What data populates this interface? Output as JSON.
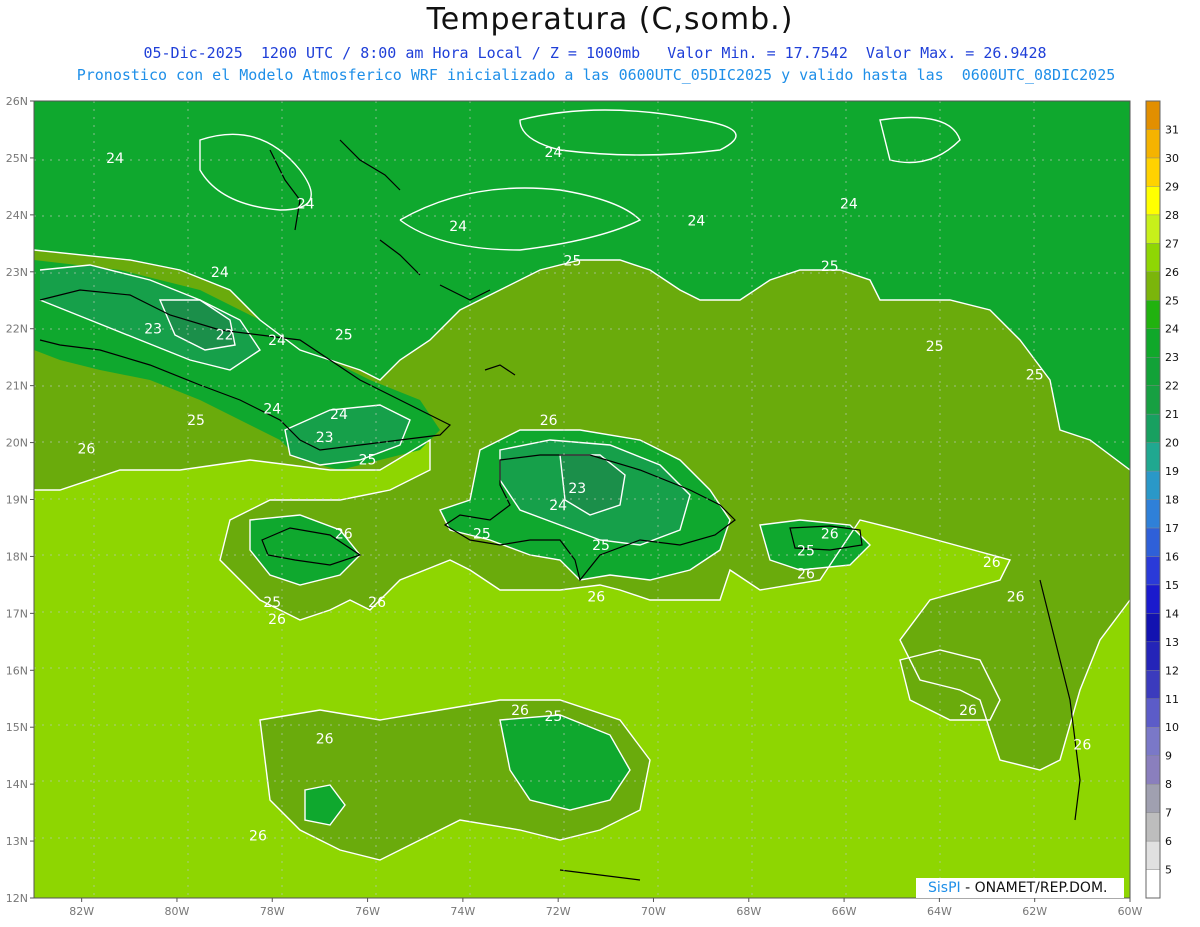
{
  "header": {
    "title": "Temperatura (C,somb.)",
    "line1": "05-Dic-2025  1200 UTC / 8:00 am Hora Local / Z = 1000mb   Valor Min. = 17.7542  Valor Max. = 26.9428",
    "line2": "Pronostico con el Modelo Atmosferico WRF inicializado a las 0600UTC_05DIC2025 y valido hasta las  0600UTC_08DIC2025"
  },
  "credit": {
    "brand": "SisPI",
    "org": " - ONAMET/REP.DOM."
  },
  "map": {
    "lon_ticks": [
      "82W",
      "80W",
      "78W",
      "76W",
      "74W",
      "72W",
      "70W",
      "68W",
      "66W",
      "64W",
      "62W",
      "60W"
    ],
    "lat_ticks": [
      "26N",
      "25N",
      "24N",
      "23N",
      "22N",
      "21N",
      "20N",
      "19N",
      "18N",
      "17N",
      "16N",
      "15N",
      "14N",
      "13N",
      "12N"
    ],
    "contour_labels": [
      {
        "t": "24",
        "lon": -81.3,
        "lat": 25.0
      },
      {
        "t": "24",
        "lon": -77.3,
        "lat": 24.2
      },
      {
        "t": "24",
        "lon": -74.1,
        "lat": 23.8
      },
      {
        "t": "24",
        "lon": -72.1,
        "lat": 25.1
      },
      {
        "t": "24",
        "lon": -69.1,
        "lat": 23.9
      },
      {
        "t": "24",
        "lon": -65.9,
        "lat": 24.2
      },
      {
        "t": "24",
        "lon": -79.1,
        "lat": 23.0
      },
      {
        "t": "25",
        "lon": -71.7,
        "lat": 23.2
      },
      {
        "t": "25",
        "lon": -66.3,
        "lat": 23.1
      },
      {
        "t": "23",
        "lon": -80.5,
        "lat": 22.0
      },
      {
        "t": "22",
        "lon": -79.0,
        "lat": 21.9
      },
      {
        "t": "24",
        "lon": -77.9,
        "lat": 21.8
      },
      {
        "t": "25",
        "lon": -76.5,
        "lat": 21.9
      },
      {
        "t": "25",
        "lon": -64.1,
        "lat": 21.7
      },
      {
        "t": "25",
        "lon": -62.0,
        "lat": 21.2
      },
      {
        "t": "24",
        "lon": -78.0,
        "lat": 20.6
      },
      {
        "t": "24",
        "lon": -76.6,
        "lat": 20.5
      },
      {
        "t": "25",
        "lon": -79.6,
        "lat": 20.4
      },
      {
        "t": "23",
        "lon": -76.9,
        "lat": 20.1
      },
      {
        "t": "26",
        "lon": -81.9,
        "lat": 19.9
      },
      {
        "t": "26",
        "lon": -72.2,
        "lat": 20.4
      },
      {
        "t": "25",
        "lon": -76.0,
        "lat": 19.7
      },
      {
        "t": "23",
        "lon": -71.6,
        "lat": 19.2
      },
      {
        "t": "24",
        "lon": -72.0,
        "lat": 18.9
      },
      {
        "t": "26",
        "lon": -76.5,
        "lat": 18.4
      },
      {
        "t": "25",
        "lon": -73.6,
        "lat": 18.4
      },
      {
        "t": "25",
        "lon": -71.1,
        "lat": 18.2
      },
      {
        "t": "26",
        "lon": -66.3,
        "lat": 18.4
      },
      {
        "t": "25",
        "lon": -66.8,
        "lat": 18.1
      },
      {
        "t": "26",
        "lon": -62.9,
        "lat": 17.9
      },
      {
        "t": "26",
        "lon": -66.8,
        "lat": 17.7
      },
      {
        "t": "25",
        "lon": -78.0,
        "lat": 17.2
      },
      {
        "t": "26",
        "lon": -75.8,
        "lat": 17.2
      },
      {
        "t": "26",
        "lon": -71.2,
        "lat": 17.3
      },
      {
        "t": "26",
        "lon": -77.9,
        "lat": 16.9
      },
      {
        "t": "26",
        "lon": -62.4,
        "lat": 17.3
      },
      {
        "t": "26",
        "lon": -63.4,
        "lat": 15.3
      },
      {
        "t": "26",
        "lon": -72.8,
        "lat": 15.3
      },
      {
        "t": "25",
        "lon": -72.1,
        "lat": 15.2
      },
      {
        "t": "26",
        "lon": -76.9,
        "lat": 14.8
      },
      {
        "t": "26",
        "lon": -61.0,
        "lat": 14.7
      },
      {
        "t": "26",
        "lon": -78.3,
        "lat": 13.1
      }
    ]
  },
  "colorbar": {
    "values": [
      "5",
      "6",
      "7",
      "8",
      "9",
      "10",
      "11",
      "12",
      "13",
      "14",
      "15",
      "16",
      "17",
      "18",
      "19",
      "20",
      "21",
      "22",
      "23",
      "24",
      "25",
      "26",
      "27",
      "28",
      "29",
      "30",
      "31"
    ],
    "colors": [
      "#ffffff",
      "#e0e0e0",
      "#bdbdbd",
      "#a0a0b0",
      "#8a7fbd",
      "#7a78c8",
      "#5c5cc8",
      "#3b3bbd",
      "#2424b8",
      "#1212b0",
      "#1a1acd",
      "#2a3ad8",
      "#2f60d8",
      "#2f80d8",
      "#2a98c8",
      "#20a890",
      "#18a060",
      "#17a042",
      "#12a238",
      "#10a82a",
      "#21b20f",
      "#7bb50b",
      "#8fd604",
      "#c8f01a",
      "#ffff00",
      "#ffd200",
      "#f5b300",
      "#e28f00",
      "#c47c00"
    ]
  },
  "palette": {
    "t22": "#1b8f4a",
    "t23": "#16a04a",
    "t24": "#0fa82e",
    "t25": "#6aab0c",
    "t26": "#8ed601",
    "contour": "#ffffff",
    "coast": "#000000"
  }
}
